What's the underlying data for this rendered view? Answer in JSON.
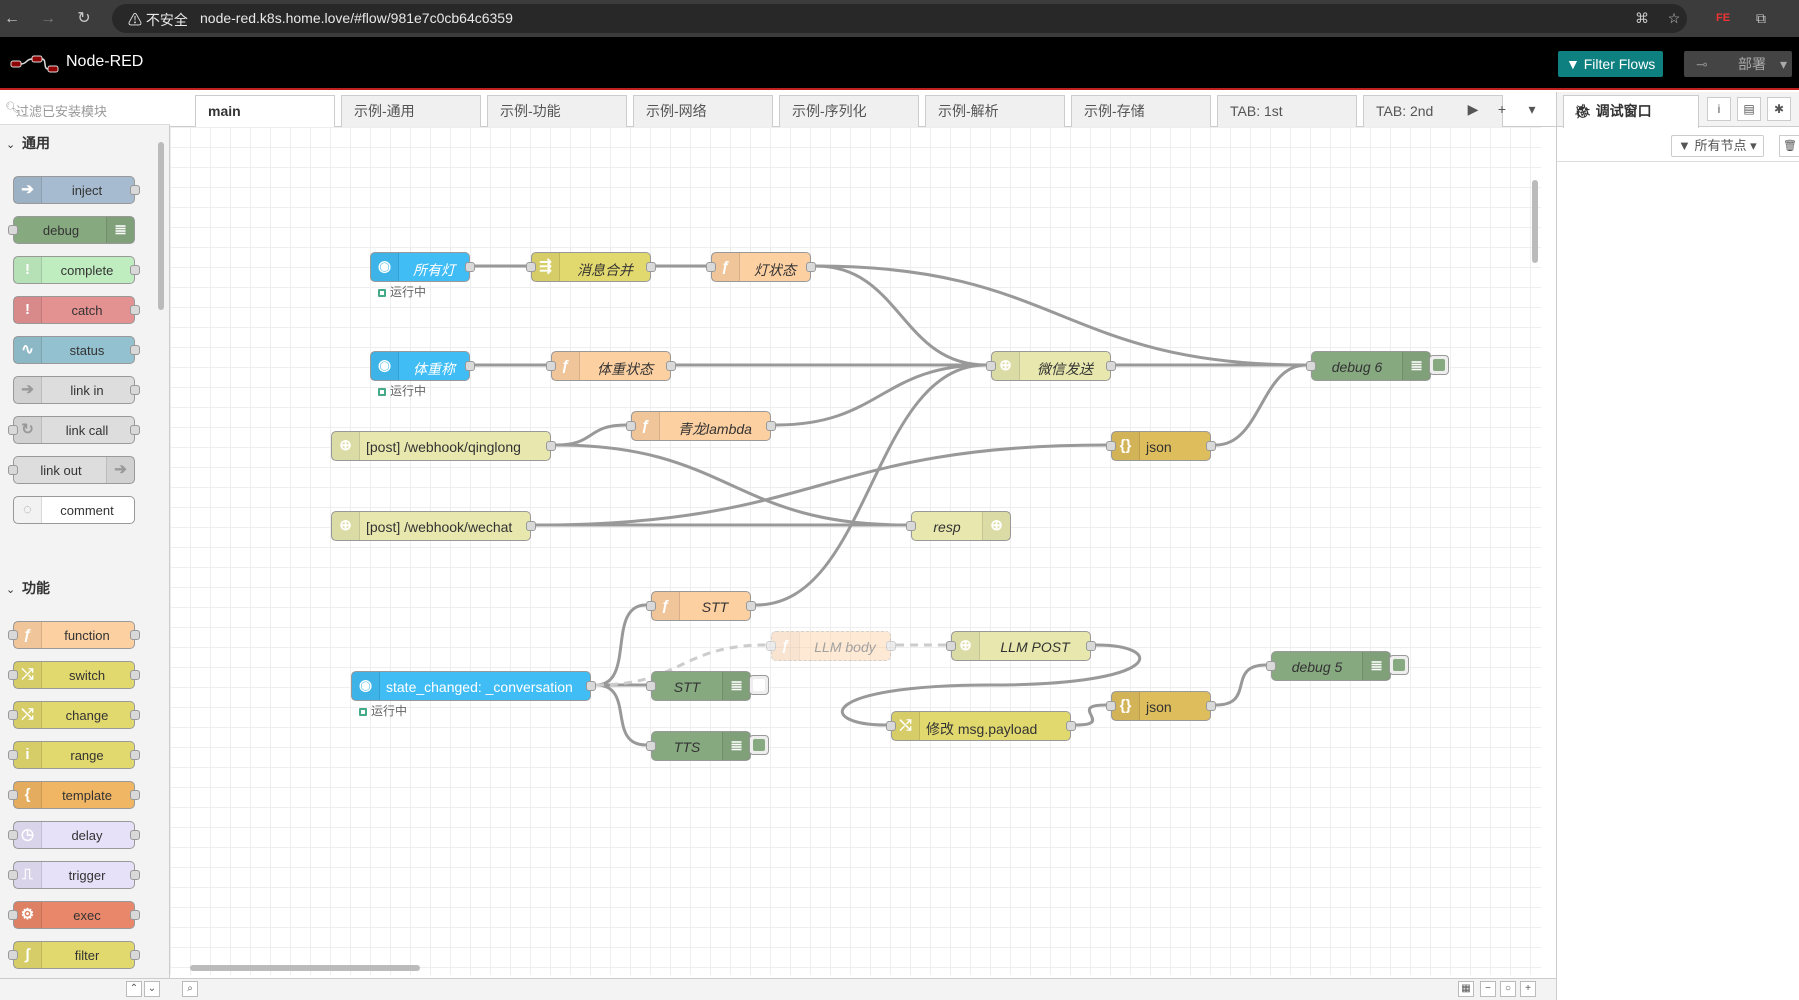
{
  "browser": {
    "security_label": "⚠ 不安全",
    "url": "node-red.k8s.home.love/#flow/981e7c0cb64c6359"
  },
  "header": {
    "app_title": "Node-RED",
    "filter_flows_label": "Filter Flows",
    "deploy_label": "部署"
  },
  "palette": {
    "search_placeholder": "过滤已安装模块",
    "categories": [
      {
        "label": "通用",
        "nodes": [
          {
            "label": "inject",
            "color": "#a6bbcf",
            "icon": "➔",
            "icon_side": "left"
          },
          {
            "label": "debug",
            "color": "#87a980",
            "icon": "≣",
            "icon_side": "right"
          },
          {
            "label": "complete",
            "color": "#c0edc0",
            "icon": "!",
            "icon_side": "left"
          },
          {
            "label": "catch",
            "color": "#e49191",
            "icon": "!",
            "icon_side": "left"
          },
          {
            "label": "status",
            "color": "#94c1d0",
            "icon": "∿",
            "icon_side": "left"
          },
          {
            "label": "link in",
            "color": "#dddddd",
            "icon": "➔",
            "icon_side": "left"
          },
          {
            "label": "link call",
            "color": "#dddddd",
            "icon": "↻",
            "icon_side": "left"
          },
          {
            "label": "link out",
            "color": "#dddddd",
            "icon": "➔",
            "icon_side": "right"
          },
          {
            "label": "comment",
            "color": "#ffffff",
            "icon": "◌",
            "icon_side": "left"
          }
        ]
      },
      {
        "label": "功能",
        "nodes": [
          {
            "label": "function",
            "color": "#fdd0a2",
            "icon": "ƒ",
            "icon_side": "left"
          },
          {
            "label": "switch",
            "color": "#e2d96e",
            "icon": "⤮",
            "icon_side": "left"
          },
          {
            "label": "change",
            "color": "#e2d96e",
            "icon": "⤭",
            "icon_side": "left"
          },
          {
            "label": "range",
            "color": "#e2d96e",
            "icon": "i",
            "icon_side": "left"
          },
          {
            "label": "template",
            "color": "#f0b664",
            "icon": "{",
            "icon_side": "left"
          },
          {
            "label": "delay",
            "color": "#e6e0f8",
            "icon": "◷",
            "icon_side": "left"
          },
          {
            "label": "trigger",
            "color": "#e6e0f8",
            "icon": "⎍",
            "icon_side": "left"
          },
          {
            "label": "exec",
            "color": "#e9876a",
            "icon": "⚙",
            "icon_side": "left"
          },
          {
            "label": "filter",
            "color": "#e2d96e",
            "icon": "∫",
            "icon_side": "left"
          }
        ]
      }
    ]
  },
  "tabs": [
    "main",
    "示例-通用",
    "示例-功能",
    "示例-网络",
    "示例-序列化",
    "示例-解析",
    "示例-存储",
    "TAB: 1st",
    "TAB: 2nd"
  ],
  "active_tab": "main",
  "flow": {
    "nodes": {
      "n_alllights": {
        "label": "所有灯",
        "type": "ha-trigger",
        "color": "#41bdf5",
        "status": "运行中"
      },
      "n_merge": {
        "label": "消息合并",
        "type": "join",
        "color": "#e2d96e"
      },
      "n_lightstate": {
        "label": "灯状态",
        "type": "function",
        "color": "#fdd0a2"
      },
      "n_scale": {
        "label": "体重称",
        "type": "ha-trigger",
        "color": "#41bdf5",
        "status": "运行中"
      },
      "n_weightstate": {
        "label": "体重状态",
        "type": "function",
        "color": "#fdd0a2"
      },
      "n_qlambda": {
        "label": "青龙lambda",
        "type": "function",
        "color": "#fdd0a2"
      },
      "n_wechat_send": {
        "label": "微信发送",
        "type": "http request",
        "color": "#e7e7ae"
      },
      "n_debug6": {
        "label": "debug 6",
        "type": "debug",
        "color": "#87a980"
      },
      "n_post_ql": {
        "label": "[post] /webhook/qinglong",
        "type": "http in",
        "color": "#e7e7ae"
      },
      "n_json1": {
        "label": "json",
        "type": "json",
        "color": "#debd5c"
      },
      "n_post_wx": {
        "label": "[post] /webhook/wechat",
        "type": "http in",
        "color": "#e7e7ae"
      },
      "n_resp": {
        "label": "resp",
        "type": "http response",
        "color": "#e7e7ae"
      },
      "n_stt_fn": {
        "label": "STT",
        "type": "function",
        "color": "#fdd0a2"
      },
      "n_llmbody": {
        "label": "LLM body",
        "type": "function",
        "color": "#fdd0a2",
        "disabled": true
      },
      "n_llmpost": {
        "label": "LLM POST",
        "type": "http request",
        "color": "#e7e7ae"
      },
      "n_debug5": {
        "label": "debug 5",
        "type": "debug",
        "color": "#87a980"
      },
      "n_conv": {
        "label": "state_changed: _conversation",
        "type": "ha-event",
        "color": "#41bdf5",
        "status": "运行中"
      },
      "n_stt_dbg": {
        "label": "STT",
        "type": "debug",
        "color": "#87a980"
      },
      "n_json2": {
        "label": "json",
        "type": "json",
        "color": "#debd5c"
      },
      "n_change": {
        "label": "修改 msg.payload",
        "type": "change",
        "color": "#e2d96e"
      },
      "n_tts_dbg": {
        "label": "TTS",
        "type": "debug",
        "color": "#87a980"
      }
    },
    "wires": [
      [
        "n_alllights",
        "n_merge"
      ],
      [
        "n_merge",
        "n_lightstate"
      ],
      [
        "n_lightstate",
        "n_wechat_send"
      ],
      [
        "n_lightstate",
        "n_debug6"
      ],
      [
        "n_scale",
        "n_weightstate"
      ],
      [
        "n_weightstate",
        "n_wechat_send"
      ],
      [
        "n_qlambda",
        "n_wechat_send"
      ],
      [
        "n_wechat_send",
        "n_debug6"
      ],
      [
        "n_post_ql",
        "n_qlambda"
      ],
      [
        "n_post_ql",
        "n_resp"
      ],
      [
        "n_post_wx",
        "n_json1"
      ],
      [
        "n_post_wx",
        "n_resp"
      ],
      [
        "n_json1",
        "n_debug6"
      ],
      [
        "n_stt_fn",
        "n_wechat_send"
      ],
      [
        "n_conv",
        "n_stt_fn"
      ],
      [
        "n_conv",
        "n_stt_dbg"
      ],
      [
        "n_conv",
        "n_tts_dbg"
      ],
      [
        "n_conv",
        "n_llmbody"
      ],
      [
        "n_llmbody",
        "n_llmpost"
      ],
      [
        "n_llmpost",
        "n_change"
      ],
      [
        "n_change",
        "n_json2"
      ],
      [
        "n_json2",
        "n_debug5"
      ]
    ]
  },
  "sidebar": {
    "active_tab_label": "调试窗口",
    "filter_label": "所有节点"
  }
}
